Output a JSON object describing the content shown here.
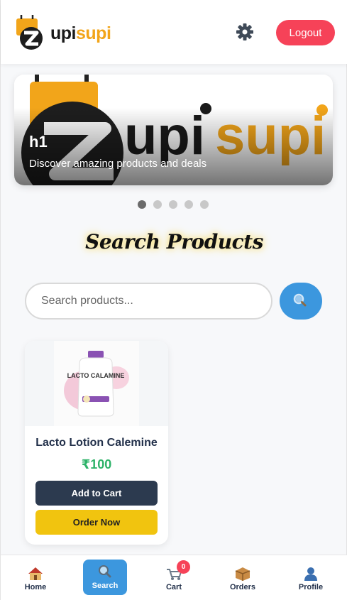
{
  "header": {
    "logo_part1": "upi",
    "logo_part2": "supi",
    "logout_label": "Logout"
  },
  "banner": {
    "title": "h1",
    "subtitle": "Discover amazing products and deals",
    "logo_part1": "upi",
    "logo_part2": "supi",
    "slide_count": 5,
    "active_slide": 1
  },
  "search": {
    "title": "Search Products",
    "placeholder": "Search products...",
    "value": ""
  },
  "products": [
    {
      "name": "Lacto Lotion Calemine",
      "price": "₹100",
      "add_to_cart_label": "Add to Cart",
      "order_now_label": "Order Now",
      "image_brand": "LACTO CALAMINE"
    }
  ],
  "nav": {
    "items": [
      {
        "label": "Home",
        "icon": "home-icon"
      },
      {
        "label": "Search",
        "icon": "search-icon"
      },
      {
        "label": "Cart",
        "icon": "cart-icon"
      },
      {
        "label": "Orders",
        "icon": "package-icon"
      },
      {
        "label": "Profile",
        "icon": "profile-icon"
      }
    ],
    "cart_count": "0",
    "active_index": 1
  },
  "colors": {
    "logout": "#f64258",
    "accent_blue": "#3c97de",
    "brand_orange": "#f2a51a",
    "add_to_cart": "#2c3a4f",
    "order_now": "#f1c40f",
    "price": "#2fb36a"
  }
}
